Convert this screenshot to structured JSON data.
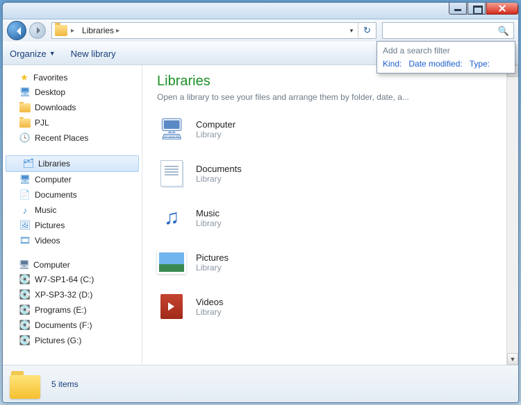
{
  "address": {
    "location": "Libraries"
  },
  "toolbar": {
    "organize": "Organize",
    "newlib": "New library"
  },
  "sidebar": {
    "favorites": {
      "label": "Favorites",
      "items": [
        {
          "label": "Desktop"
        },
        {
          "label": "Downloads"
        },
        {
          "label": "PJL"
        },
        {
          "label": "Recent Places"
        }
      ]
    },
    "libraries": {
      "label": "Libraries",
      "items": [
        {
          "label": "Computer"
        },
        {
          "label": "Documents"
        },
        {
          "label": "Music"
        },
        {
          "label": "Pictures"
        },
        {
          "label": "Videos"
        }
      ]
    },
    "computer": {
      "label": "Computer",
      "items": [
        {
          "label": "W7-SP1-64 (C:)"
        },
        {
          "label": "XP-SP3-32 (D:)"
        },
        {
          "label": "Programs (E:)"
        },
        {
          "label": "Documents (F:)"
        },
        {
          "label": "Pictures (G:)"
        }
      ]
    }
  },
  "main": {
    "title": "Libraries",
    "subtitle": "Open a library to see your files and arrange them by folder, date, a...",
    "type_label": "Library",
    "items": [
      {
        "name": "Computer"
      },
      {
        "name": "Documents"
      },
      {
        "name": "Music"
      },
      {
        "name": "Pictures"
      },
      {
        "name": "Videos"
      }
    ]
  },
  "status": {
    "text": "5 items"
  },
  "search_filter": {
    "heading": "Add a search filter",
    "kind": "Kind:",
    "date": "Date modified:",
    "type": "Type:"
  }
}
